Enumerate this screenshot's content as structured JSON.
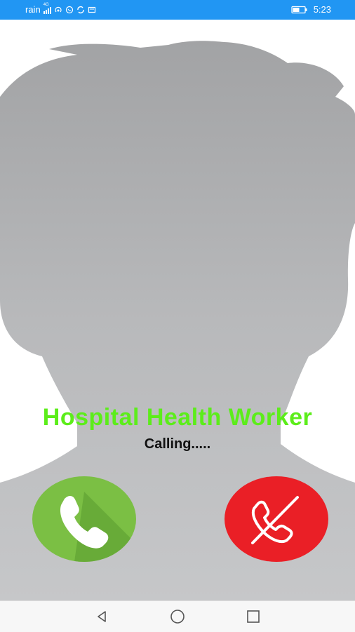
{
  "status_bar": {
    "carrier": "rain",
    "network_badge": "4G",
    "time": "5:23",
    "left_icons": [
      "signal-icon",
      "hotspot-icon",
      "whatsapp-icon",
      "sync-icon",
      "message-icon"
    ],
    "right_icons": [
      "battery-icon"
    ]
  },
  "call": {
    "caller_name": "Hospital Health Worker",
    "status": "Calling.....",
    "name_color": "#5ced1a"
  },
  "buttons": {
    "accept_icon": "phone-icon",
    "decline_icon": "phone-hangup-icon",
    "accept_color": "#7bbf44",
    "decline_color": "#ea1f26"
  },
  "nav": {
    "back_icon": "back-icon",
    "home_icon": "home-icon",
    "recents_icon": "recents-icon"
  }
}
